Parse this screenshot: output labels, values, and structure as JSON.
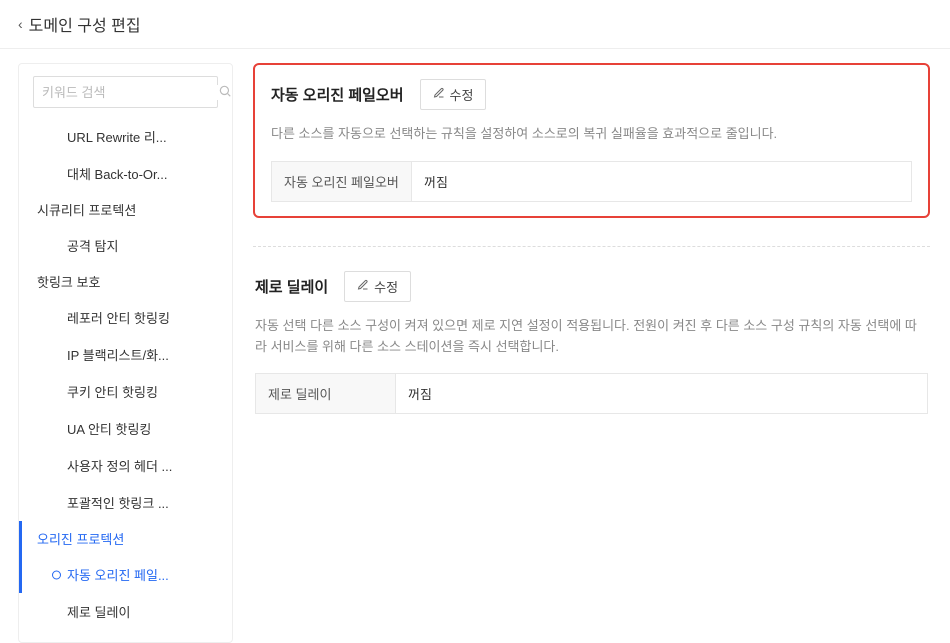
{
  "header": {
    "back_glyph": "‹",
    "title": "도메인 구성 편집"
  },
  "sidebar": {
    "search_placeholder": "키워드 검색",
    "items": [
      {
        "type": "item",
        "label": "URL Rewrite 리..."
      },
      {
        "type": "item",
        "label": "대체 Back-to-Or..."
      },
      {
        "type": "group",
        "label": "시큐리티 프로텍션"
      },
      {
        "type": "item",
        "label": "공격 탐지"
      },
      {
        "type": "group",
        "label": "핫링크 보호"
      },
      {
        "type": "item",
        "label": "레포러 안티 핫링킹"
      },
      {
        "type": "item",
        "label": "IP 블랙리스트/화..."
      },
      {
        "type": "item",
        "label": "쿠키 안티 핫링킹"
      },
      {
        "type": "item",
        "label": "UA 안티 핫링킹"
      },
      {
        "type": "item",
        "label": "사용자 정의 헤더 ..."
      },
      {
        "type": "item",
        "label": "포괄적인 핫링크 ..."
      },
      {
        "type": "group",
        "label": "오리진 프로텍션",
        "active": true
      },
      {
        "type": "item",
        "label": "자동 오리진 페일...",
        "active": true
      },
      {
        "type": "item",
        "label": "제로 딜레이"
      }
    ]
  },
  "panels": {
    "failover": {
      "title": "자동 오리진 페일오버",
      "edit_label": "수정",
      "desc": "다른 소스를 자동으로 선택하는 규칙을 설정하여 소스로의 복귀 실패율을 효과적으로 줄입니다.",
      "row_key": "자동 오리진 페일오버",
      "row_val": "꺼짐"
    },
    "zerodelay": {
      "title": "제로 딜레이",
      "edit_label": "수정",
      "desc": "자동 선택 다른 소스 구성이 켜져 있으면 제로 지연 설정이 적용됩니다. 전원이 켜진 후 다른 소스 구성 규칙의 자동 선택에 따라 서비스를 위해 다른 소스 스테이션을 즉시 선택합니다.",
      "row_key": "제로 딜레이",
      "row_val": "꺼짐"
    }
  }
}
